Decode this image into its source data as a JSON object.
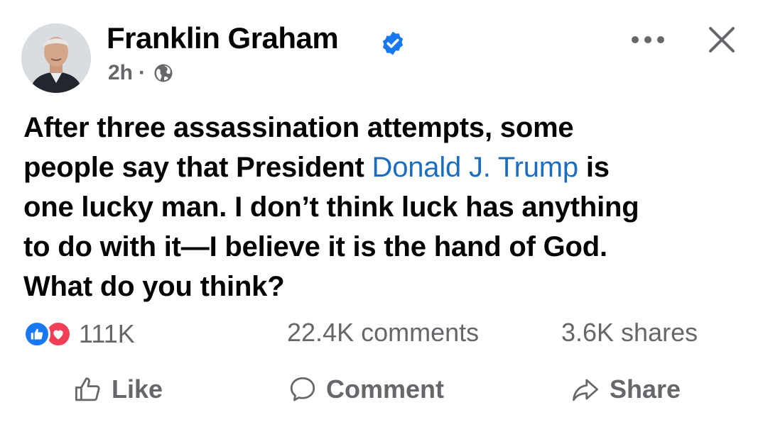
{
  "post": {
    "author": "Franklin Graham",
    "timestamp": "2h",
    "separator": "·",
    "text": {
      "line1": "After three assassination attempts, some",
      "line2_before": "people say that President ",
      "line2_mention": "Donald J. Trump",
      "line2_after": " is",
      "line3": "one lucky man. I don’t think luck has anything",
      "line4": "to do with it—I believe it is the hand of God.",
      "line5": "What do you think?"
    }
  },
  "stats": {
    "reactions": "111K",
    "comments": "22.4K comments",
    "shares": "3.6K shares"
  },
  "actions": {
    "like": "Like",
    "comment": "Comment",
    "share": "Share"
  },
  "icons": {
    "verified": "verified-badge-icon",
    "audience": "globe-icon",
    "more": "more-options-icon",
    "close": "close-icon",
    "like_reaction": "like-reaction-icon",
    "love_reaction": "love-reaction-icon",
    "like_action": "thumbs-up-icon",
    "comment_action": "comment-bubble-icon",
    "share_action": "share-arrow-icon"
  },
  "colors": {
    "mention": "#1b6dc1",
    "verified": "#1877f2",
    "secondary_text": "#65676b",
    "like": "#1877f2",
    "love": "#f33e58"
  }
}
